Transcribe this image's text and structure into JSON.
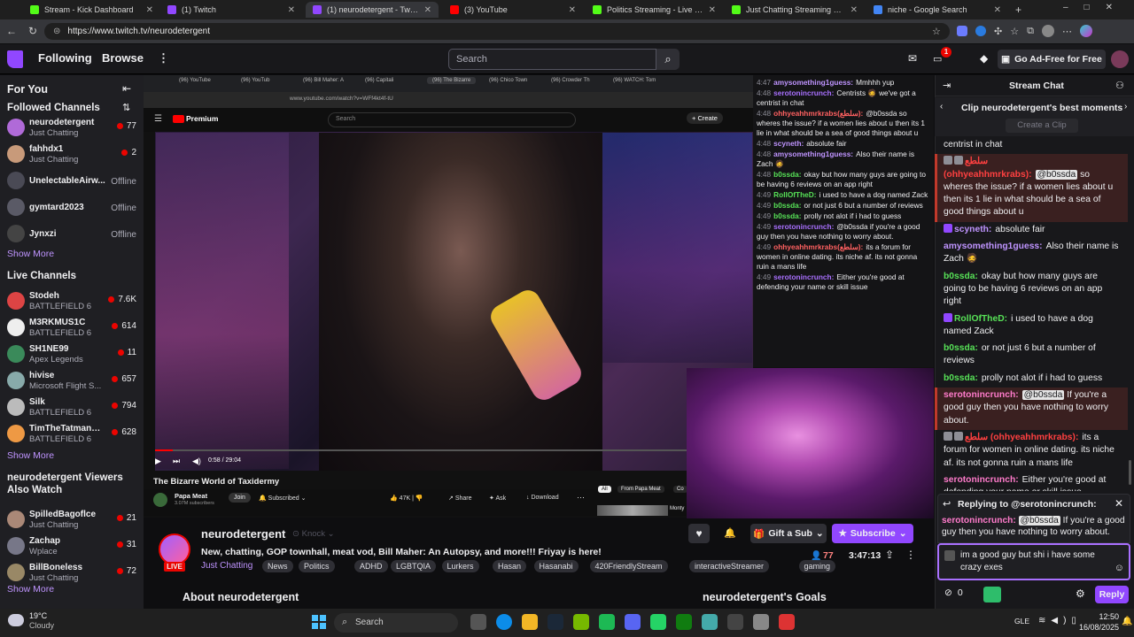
{
  "browser": {
    "tabs": [
      {
        "title": "Stream - Kick Dashboard",
        "icon": "kick-icon",
        "color": "#53fc18",
        "active": false
      },
      {
        "title": "(1) Twitch",
        "icon": "twitch-icon",
        "color": "#9147ff",
        "active": false
      },
      {
        "title": "(1) neurodetergent - Twitch",
        "icon": "twitch-icon",
        "color": "#9147ff",
        "active": true
      },
      {
        "title": "(3) YouTube",
        "icon": "youtube-icon",
        "color": "#ff0000",
        "active": false
      },
      {
        "title": "Politics Streaming - Live Streams",
        "icon": "kick-icon",
        "color": "#53fc18",
        "active": false
      },
      {
        "title": "Just Chatting Streaming - Live St",
        "icon": "kick-icon",
        "color": "#53fc18",
        "active": false
      },
      {
        "title": "niche - Google Search",
        "icon": "google-icon",
        "color": "#4285f4",
        "active": false
      }
    ],
    "url": "https://www.twitch.tv/neurodetergent"
  },
  "topnav": {
    "following": "Following",
    "browse": "Browse",
    "search_placeholder": "Search",
    "notif_count": "1",
    "adfree": "Go Ad-Free for Free"
  },
  "sidebar": {
    "for_you": "For You",
    "followed_heading": "Followed Channels",
    "followed": [
      {
        "name": "neurodetergent",
        "game": "Just Chatting",
        "count": "77",
        "live": true,
        "color": "#b06ad8"
      },
      {
        "name": "fahhdx1",
        "game": "Just Chatting",
        "count": "2",
        "live": true,
        "color": "#c89a7a"
      },
      {
        "name": "UnelectableAirw...",
        "game": "",
        "count": "Offline",
        "live": false,
        "color": "#4a4a55"
      },
      {
        "name": "gymtard2023",
        "game": "",
        "count": "Offline",
        "live": false,
        "color": "#5a5a66"
      },
      {
        "name": "Jynxzi",
        "game": "",
        "count": "Offline",
        "live": false,
        "color": "#444"
      }
    ],
    "show_more": "Show More",
    "live_heading": "Live Channels",
    "live": [
      {
        "name": "Stodeh",
        "game": "BATTLEFIELD 6",
        "count": "7.6K",
        "color": "#d44"
      },
      {
        "name": "M3RKMUS1C",
        "game": "BATTLEFIELD 6",
        "count": "614",
        "color": "#eee"
      },
      {
        "name": "SH1NE99",
        "game": "Apex Legends",
        "count": "11",
        "color": "#3a8a5a"
      },
      {
        "name": "hivise",
        "game": "Microsoft Flight S...",
        "count": "657",
        "color": "#8aa"
      },
      {
        "name": "Silk",
        "game": "BATTLEFIELD 6",
        "count": "794",
        "color": "#bbb"
      },
      {
        "name": "TimTheTatmanVO...",
        "game": "BATTLEFIELD 6",
        "count": "628",
        "color": "#e94"
      }
    ],
    "viewers_heading": "neurodetergent Viewers Also Watch",
    "viewers_watch": [
      {
        "name": "SpilledBagoflce",
        "game": "Just Chatting",
        "count": "21",
        "color": "#a87"
      },
      {
        "name": "Zachap",
        "game": "Wplace",
        "count": "31",
        "color": "#778"
      },
      {
        "name": "BillBoneless",
        "game": "Just Chatting",
        "count": "72",
        "color": "#986"
      }
    ]
  },
  "player": {
    "yt_tabs": [
      "(96) YouTube",
      "(96) YouTub",
      "(96) Bill Maher: A",
      "(96) Capitali",
      "(96) The Bizarre",
      "(96) Chico Town",
      "(96) Crowder Th",
      "(96) WATCH: Tom"
    ],
    "yt_url": "www.youtube.com/watch?v=WFf4kt4f-tU",
    "yt_logo": "Premium",
    "yt_search": "Search",
    "yt_create": "Create",
    "yt_time": "0:58 / 29:04",
    "yt_title": "The Bizarre World of Taxidermy",
    "yt_channel": "Papa Meat",
    "yt_subs": "3.07M subscribers",
    "yt_join": "Join",
    "yt_subscribed": "Subscribed",
    "yt_likes": "47K",
    "yt_share": "Share",
    "yt_ask": "Ask",
    "yt_download": "Download",
    "yt_filter_all": "All",
    "yt_filter_papa": "From Papa Meat",
    "yt_filter_more": "Co",
    "yt_side_label": "Monty",
    "overlay_chat": [
      {
        "time": "4:47",
        "user": "amysomething1guess:",
        "color": "#bf94ff",
        "text": "Mmhhh yup"
      },
      {
        "time": "4:48",
        "user": "serotonincrunch:",
        "color": "#a970ff",
        "text": "Centrists 🧔 we've got a centrist in chat"
      },
      {
        "time": "4:48",
        "user": "ohhyeahhmrkrabs(سلطع):",
        "color": "#ff6060",
        "text": "@b0ssda so wheres the issue? if a women lies about u then its 1 lie in what should be a sea of good things about u"
      },
      {
        "time": "4:48",
        "user": "scyneth:",
        "color": "#bf94ff",
        "text": "absolute fair"
      },
      {
        "time": "4:48",
        "user": "amysomething1guess:",
        "color": "#bf94ff",
        "text": "Also their name is Zach 🧔"
      },
      {
        "time": "4:48",
        "user": "b0ssda:",
        "color": "#57e257",
        "text": "okay but how many guys are going to be having 6 reviews on an app right"
      },
      {
        "time": "4:49",
        "user": "RollOfTheD:",
        "color": "#57e257",
        "text": "i used to have a dog named Zack"
      },
      {
        "time": "4:49",
        "user": "b0ssda:",
        "color": "#57e257",
        "text": "or not just 6 but a number of reviews"
      },
      {
        "time": "4:49",
        "user": "b0ssda:",
        "color": "#57e257",
        "text": "prolly not alot if i had to guess"
      },
      {
        "time": "4:49",
        "user": "serotonincrunch:",
        "color": "#a970ff",
        "text": "@b0ssda if you're a good guy then you have nothing to worry about."
      },
      {
        "time": "4:49",
        "user": "ohhyeahhmrkrabs(سلطع):",
        "color": "#ff6060",
        "text": "its a forum for women in online dating. its niche af. its not gonna ruin a mans life"
      },
      {
        "time": "4:49",
        "user": "serotonincrunch:",
        "color": "#a970ff",
        "text": "Either you're good at defending your name or skill issue"
      }
    ]
  },
  "channel": {
    "name": "neurodetergent",
    "knock": "Knock",
    "live": "LIVE",
    "title": "New, chatting, GOP townhall, meat vod, Bill Maher: An Autopsy, and more!!! Friyay is here!",
    "category": "Just Chatting",
    "tags": [
      "News",
      "Politics",
      "ADHD",
      "LGBTQIA",
      "Lurkers",
      "Hasan",
      "Hasanabi",
      "420FriendlyStream",
      "interactiveStreamer",
      "gaming"
    ],
    "gift": "Gift a Sub",
    "subscribe": "Subscribe",
    "viewers": "77",
    "uptime": "3:47:13",
    "about": "About neurodetergent",
    "goals": "neurodetergent's Goals"
  },
  "chat": {
    "header": "Stream Chat",
    "clip_title": "Clip neurodetergent's best moments",
    "create_clip": "Create a Clip",
    "messages": [
      {
        "user": "",
        "color": "#efeff1",
        "text": "centrist in chat",
        "hl": false,
        "mention": ""
      },
      {
        "user": "سلطع (ohhyeahhmrkrabs):",
        "color": "#ff4040",
        "text": "so wheres the issue? if a women lies about u then its 1 lie in what should be a sea of good things about u",
        "hl": true,
        "mention": "@b0ssda"
      },
      {
        "user": "scyneth:",
        "color": "#bf94ff",
        "text": "absolute fair",
        "hl": false,
        "mention": ""
      },
      {
        "user": "amysomething1guess:",
        "color": "#bf94ff",
        "text": "Also their name is Zach 🧔",
        "hl": false,
        "mention": ""
      },
      {
        "user": "b0ssda:",
        "color": "#57e257",
        "text": "okay but how many guys are going to be having 6 reviews on an app right",
        "hl": false,
        "mention": ""
      },
      {
        "user": "RollOfTheD:",
        "color": "#57e257",
        "text": "i used to have a dog named Zack",
        "hl": false,
        "mention": ""
      },
      {
        "user": "b0ssda:",
        "color": "#57e257",
        "text": "or not just 6 but a number of reviews",
        "hl": false,
        "mention": ""
      },
      {
        "user": "b0ssda:",
        "color": "#57e257",
        "text": "prolly not alot if i had to guess",
        "hl": false,
        "mention": ""
      },
      {
        "user": "serotonincrunch:",
        "color": "#ff7bcb",
        "text": "If you're a good guy then you have nothing to worry about.",
        "hl": true,
        "mention": "@b0ssda"
      },
      {
        "user": "سلطع (ohhyeahhmrkrabs):",
        "color": "#ff4040",
        "text": "its a forum for women in online dating. its niche af. its not gonna ruin a mans life",
        "hl": false,
        "mention": ""
      },
      {
        "user": "serotonincrunch:",
        "color": "#ff7bcb",
        "text": "Either you're good at defending your name or skill issue",
        "hl": false,
        "mention": ""
      }
    ],
    "replying_to": "Replying to @serotonincrunch:",
    "reply_user": "serotonincrunch:",
    "reply_mention": "@b0ssda",
    "reply_text": "If you're a good guy then you have nothing to worry about.",
    "input_value": "im a good guy but shi i have some crazy exes",
    "points": "0",
    "reply_button": "Reply"
  },
  "taskbar": {
    "temp": "19°C",
    "weather": "Cloudy",
    "search": "Search",
    "lang": "GLE",
    "time": "12:50",
    "date": "16/08/2025"
  }
}
